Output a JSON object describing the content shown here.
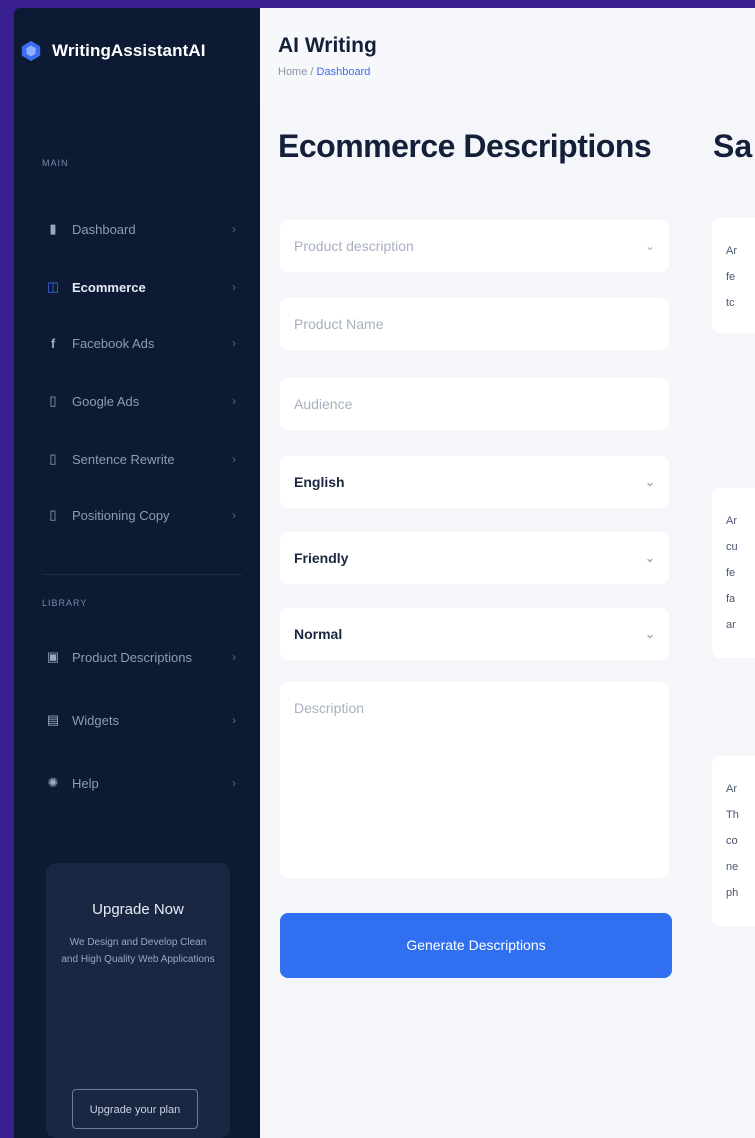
{
  "brand": {
    "name": "WritingAssistantAI"
  },
  "sidebar": {
    "section_main": "MAIN",
    "items": [
      {
        "icon": "bar-chart-icon",
        "label": "Dashboard"
      },
      {
        "icon": "shopping-bag-icon",
        "label": "Ecommerce"
      },
      {
        "icon": "facebook-icon",
        "label": "Facebook Ads"
      },
      {
        "icon": "google-icon",
        "label": "Google Ads"
      },
      {
        "icon": "rewrite-icon",
        "label": "Sentence Rewrite"
      },
      {
        "icon": "document-icon",
        "label": "Positioning Copy"
      }
    ],
    "section_library": "LIBRARY",
    "library_items": [
      {
        "icon": "box-icon",
        "label": "Product Descriptions"
      },
      {
        "icon": "widget-icon",
        "label": "Widgets"
      },
      {
        "icon": "help-icon",
        "label": "Help"
      }
    ],
    "upgrade": {
      "title": "Upgrade Now",
      "description": "We Design and Develop Clean and High Quality Web Applications",
      "button": "Upgrade your plan"
    }
  },
  "header": {
    "title": "AI Writing",
    "breadcrumb_home": "Home",
    "breadcrumb_sep": "/",
    "breadcrumb_current": "Dashboard"
  },
  "form": {
    "title": "Ecommerce Descriptions",
    "product_description_placeholder": "Product description",
    "product_name_placeholder": "Product Name",
    "audience_placeholder": "Audience",
    "language_value": "English",
    "tone_value": "Friendly",
    "length_value": "Normal",
    "description_placeholder": "Description",
    "generate_button": "Generate Descriptions"
  },
  "samples": {
    "title": "Sa",
    "cards": [
      {
        "lines": [
          "Ar",
          "fe",
          "tc"
        ]
      },
      {
        "lines": [
          "Ar",
          "cu",
          "fe",
          "fa",
          "ar"
        ]
      },
      {
        "lines": [
          "Ar",
          "Th",
          "co",
          "ne",
          "ph"
        ]
      }
    ]
  },
  "colors": {
    "frame": "#3a1f8f",
    "sidebar_bg": "#0d1a33",
    "accent": "#2f6ff0",
    "main_bg": "#f4f6fa"
  }
}
